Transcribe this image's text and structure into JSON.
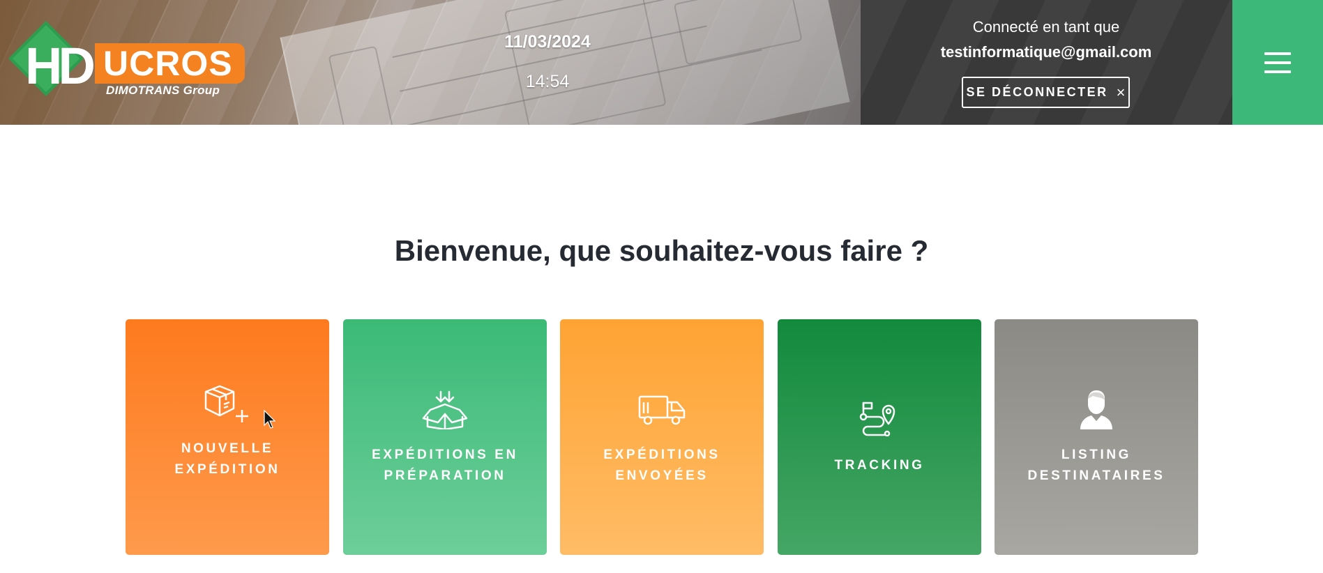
{
  "header": {
    "logo": {
      "letters_hd": "HD",
      "letters_ucros": "UCROS",
      "group": "DIMOTRANS Group"
    },
    "date": "11/03/2024",
    "time": "14:54",
    "user": {
      "connected_label": "Connecté en tant que",
      "email": "testinformatique@gmail.com"
    },
    "logout_label": "SE DÉCONNECTER",
    "logout_icon": "×",
    "menu_icon": "hamburger-icon"
  },
  "main": {
    "welcome": "Bienvenue, que souhaitez-vous faire ?",
    "tiles": [
      {
        "line1": "NOUVELLE",
        "line2": "EXPÉDITION",
        "icon": "box-plus-icon",
        "color": "#fe7a1e"
      },
      {
        "line1": "EXPÉDITIONS EN",
        "line2": "PRÉPARATION",
        "icon": "box-open-arrow-icon",
        "color": "#3bba76"
      },
      {
        "line1": "EXPÉDITIONS",
        "line2": "ENVOYÉES",
        "icon": "truck-icon",
        "color": "#ffa333"
      },
      {
        "line1": "TRACKING",
        "line2": "",
        "icon": "route-pin-icon",
        "color": "#128a3c"
      },
      {
        "line1": "LISTING",
        "line2": "DESTINATAIRES",
        "icon": "person-icon",
        "color": "#8b8a85"
      }
    ]
  },
  "colors": {
    "brand_orange": "#f58220",
    "brand_green": "#3cb878",
    "text_dark": "#262b33"
  }
}
